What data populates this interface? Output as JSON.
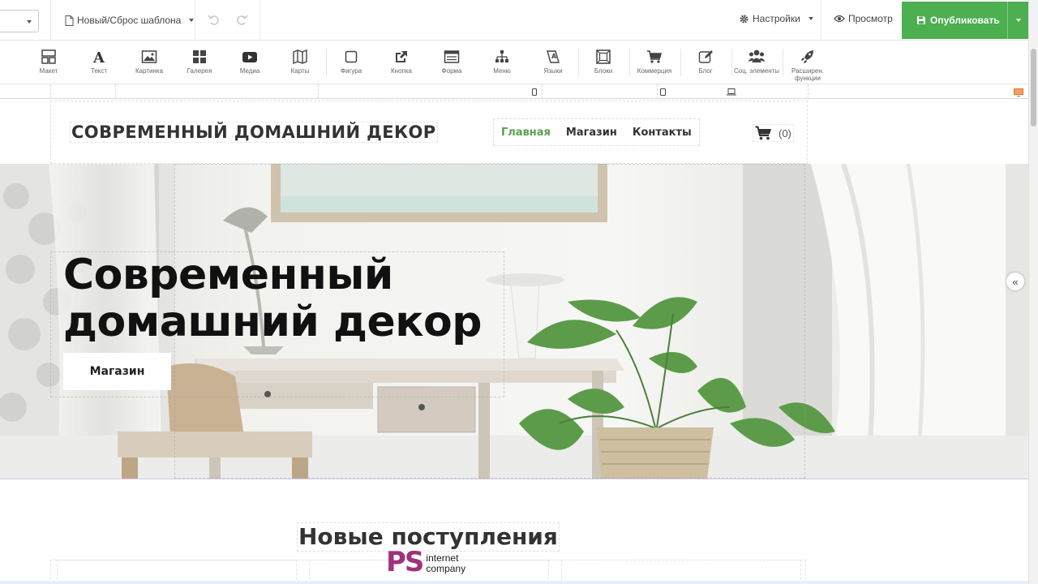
{
  "topbar": {
    "template_label": "Новый/Сброс шаблона",
    "settings_label": "Настройки",
    "preview_label": "Просмотр",
    "publish_label": "Опубликовать"
  },
  "elements_toolbar": [
    {
      "label": "Макет",
      "icon": "layout-icon"
    },
    {
      "label": "Текст",
      "icon": "text-icon"
    },
    {
      "label": "Картинка",
      "icon": "image-icon"
    },
    {
      "label": "Галерея",
      "icon": "gallery-icon"
    },
    {
      "label": "Медиа",
      "icon": "media-icon"
    },
    {
      "label": "Карты",
      "icon": "map-icon"
    },
    {
      "label": "Фигура",
      "icon": "shape-icon"
    },
    {
      "label": "Кнопка",
      "icon": "button-icon"
    },
    {
      "label": "Форма",
      "icon": "form-icon"
    },
    {
      "label": "Меню",
      "icon": "menu-icon"
    },
    {
      "label": "Языки",
      "icon": "languages-icon"
    },
    {
      "label": "Блоки",
      "icon": "blocks-icon"
    },
    {
      "label": "Коммерция",
      "icon": "commerce-icon"
    },
    {
      "label": "Блог",
      "icon": "blog-icon"
    },
    {
      "label": "Соц. элементы",
      "icon": "social-icon"
    },
    {
      "label": "Расширен. функции",
      "icon": "rocket-icon"
    }
  ],
  "site": {
    "logo_text": "СОВРЕМЕННЫЙ ДОМАШНИЙ ДЕКОР",
    "nav": [
      {
        "label": "Главная",
        "active": true
      },
      {
        "label": "Магазин",
        "active": false
      },
      {
        "label": "Контакты",
        "active": false
      }
    ],
    "cart_count": "(0)",
    "hero": {
      "title_line1": "Современный",
      "title_line2": "домашний декор",
      "button_label": "Магазин"
    },
    "section_title": "Новые поступления"
  },
  "watermark": {
    "letters": "PS",
    "line1": "internet",
    "line2": "company"
  },
  "colors": {
    "publish_green": "#4caf50",
    "nav_active": "#5aa04d",
    "watermark_magenta": "#a0317c"
  }
}
